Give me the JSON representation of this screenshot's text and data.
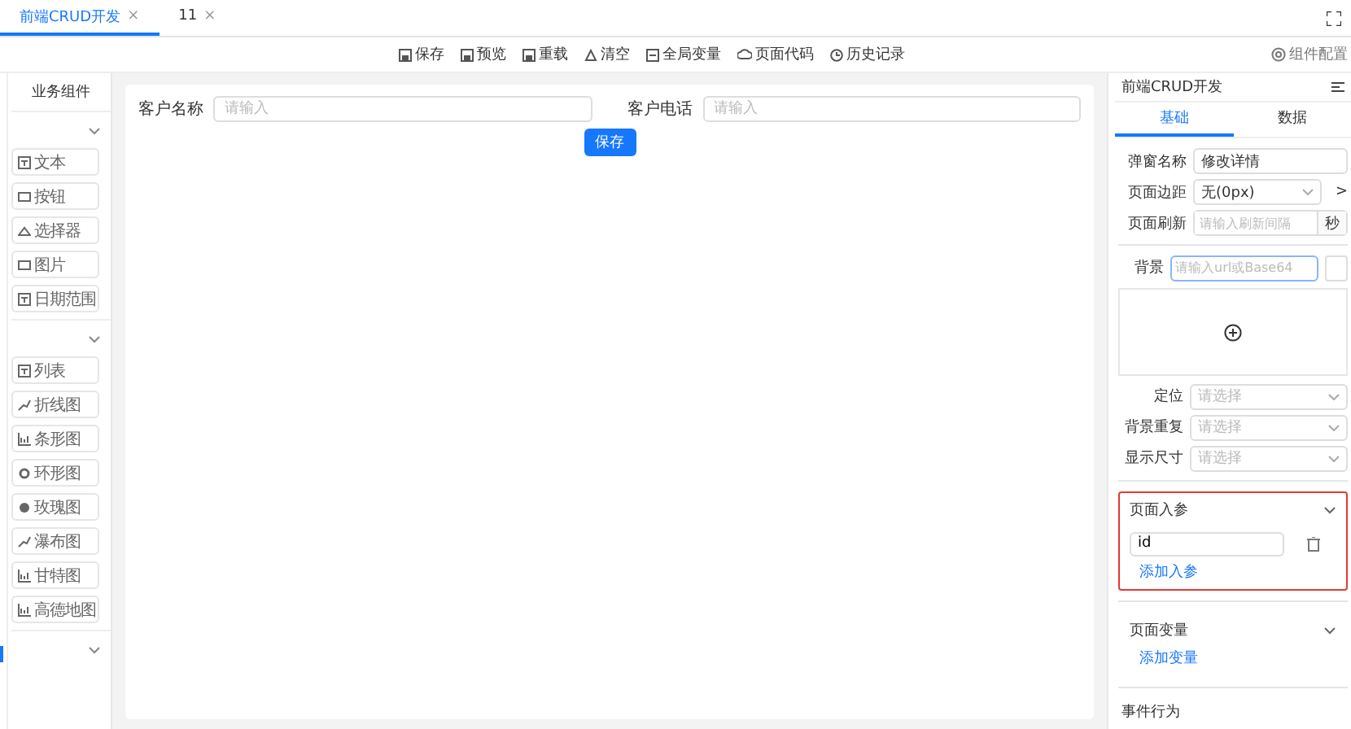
{
  "tabs": [
    {
      "label": "前端CRUD开发",
      "selected": true,
      "close": "×"
    },
    {
      "label": "11",
      "selected": false,
      "close": "×"
    }
  ],
  "toolbar": [
    {
      "kind": "save",
      "label": "保存"
    },
    {
      "kind": "preview",
      "label": "预览"
    },
    {
      "kind": "reload",
      "label": "重载"
    },
    {
      "kind": "clear",
      "label": "清空"
    },
    {
      "kind": "vars",
      "label": "全局变量"
    },
    {
      "kind": "code",
      "label": "页面代码"
    },
    {
      "kind": "history",
      "label": "历史记录"
    }
  ],
  "config_button": "组件配置",
  "sidebar": {
    "title": "业务组件",
    "groups": [
      {
        "expanded": true,
        "items": [
          {
            "kind": "text",
            "label": "文本"
          },
          {
            "kind": "button",
            "label": "按钮"
          },
          {
            "kind": "select",
            "label": "选择器"
          },
          {
            "kind": "image",
            "label": "图片"
          },
          {
            "kind": "date",
            "label": "日期范围"
          }
        ]
      },
      {
        "expanded": true,
        "items": [
          {
            "kind": "table",
            "label": "列表"
          },
          {
            "kind": "line",
            "label": "折线图"
          },
          {
            "kind": "bar",
            "label": "条形图"
          },
          {
            "kind": "ring",
            "label": "环形图"
          },
          {
            "kind": "rose",
            "label": "玫瑰图"
          },
          {
            "kind": "waterfall",
            "label": "瀑布图"
          },
          {
            "kind": "bar",
            "label": "甘特图"
          },
          {
            "kind": "bar",
            "label": "高德地图"
          }
        ]
      },
      {
        "expanded": true
      }
    ]
  },
  "canvas": {
    "fields": [
      {
        "label": "客户名称",
        "placeholder": "请输入"
      },
      {
        "label": "客户电话",
        "placeholder": "请输入"
      }
    ],
    "button": "保存"
  },
  "panel": {
    "title": "前端CRUD开发",
    "tabs": [
      {
        "label": "基础",
        "selected": true
      },
      {
        "label": "数据",
        "selected": false
      }
    ],
    "dialog_name": {
      "label": "弹窗名称",
      "value": "修改详情"
    },
    "padding": {
      "label": "页面边距",
      "value": "无(0px)",
      "more": ">"
    },
    "refresh": {
      "label": "页面刷新",
      "placeholder": "请输入刷新间隔",
      "unit": "秒"
    },
    "background": {
      "label": "背景",
      "placeholder": "请输入url或Base64"
    },
    "selects": [
      {
        "label": "定位",
        "placeholder": "请选择"
      },
      {
        "label": "背景重复",
        "placeholder": "请选择"
      },
      {
        "label": "显示尺寸",
        "placeholder": "请选择"
      }
    ],
    "sections": [
      {
        "title": "页面入参",
        "expanded": true,
        "highlighted": true,
        "params": [
          "id"
        ],
        "add": "添加入参"
      },
      {
        "title": "页面变量",
        "expanded": true,
        "highlighted": false,
        "add": "添加变量"
      }
    ],
    "events_title": "事件行为"
  }
}
